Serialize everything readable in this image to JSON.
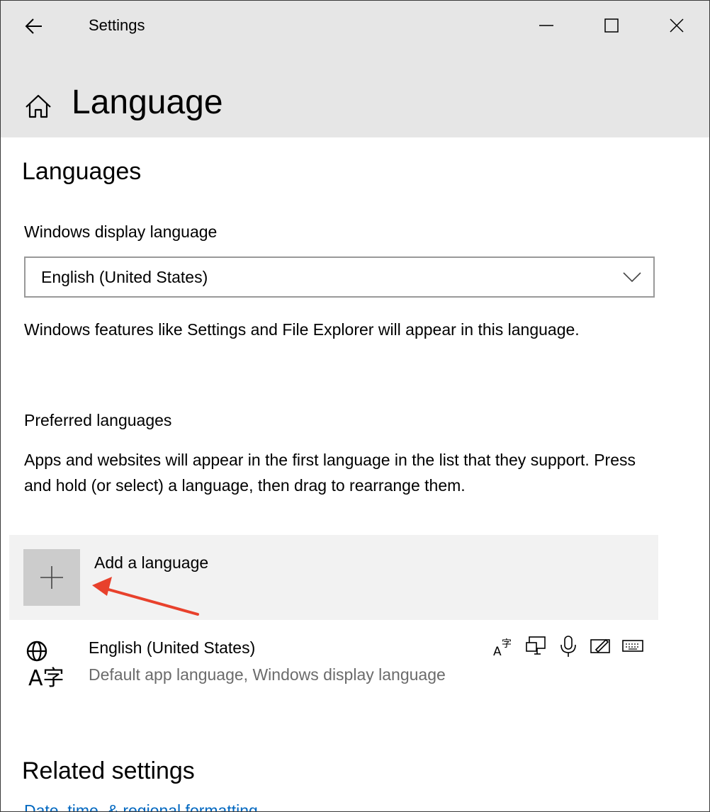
{
  "window": {
    "title": "Settings",
    "page_title": "Language"
  },
  "languages": {
    "heading": "Languages",
    "display_language_label": "Windows display language",
    "display_language_value": "English (United States)",
    "display_language_desc": "Windows features like Settings and File Explorer will appear in this language.",
    "preferred_label": "Preferred languages",
    "preferred_desc": "Apps and websites will appear in the first language in the list that they support. Press and hold (or select) a language, then drag to rearrange them.",
    "add_label": "Add a language",
    "installed": [
      {
        "name": "English (United States)",
        "detail": "Default app language, Windows display language",
        "features": [
          "text-to-speech-icon",
          "display-language-icon",
          "speech-icon",
          "handwriting-icon",
          "keyboard-icon"
        ]
      }
    ]
  },
  "related": {
    "heading": "Related settings",
    "link": "Date, time, & regional formatting"
  },
  "colors": {
    "titlebar": "#e6e6e6",
    "add_row": "#f2f2f2",
    "add_button": "#cccccc",
    "annotation_arrow": "#e8412c",
    "link": "#0067c0"
  }
}
